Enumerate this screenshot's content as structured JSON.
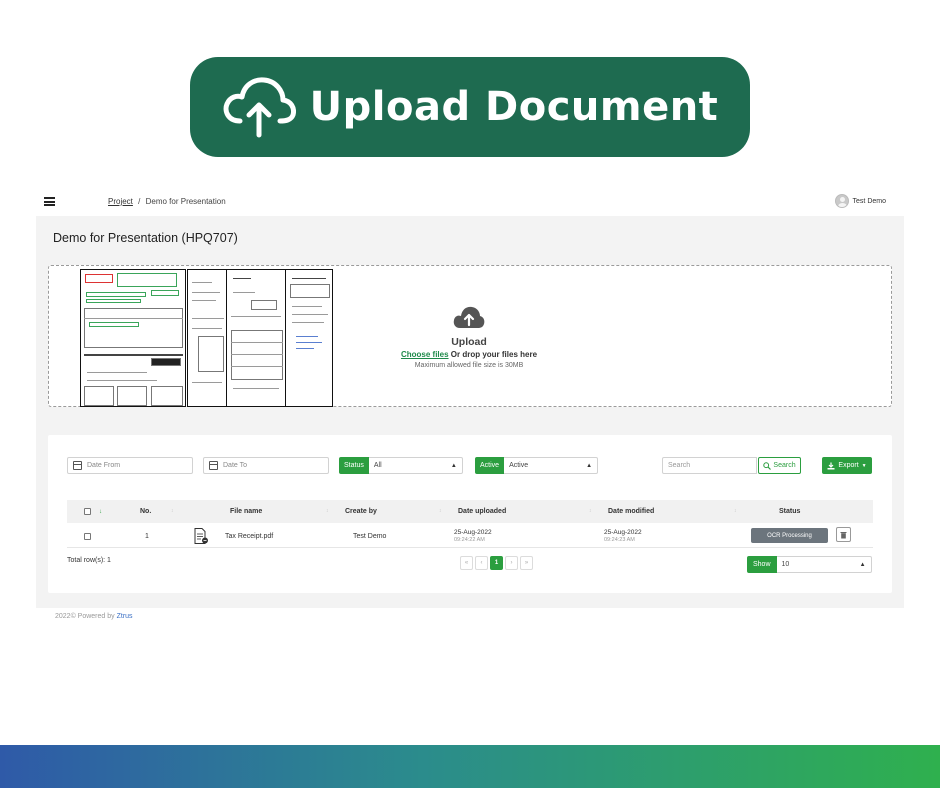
{
  "banner": {
    "title": "Upload Document",
    "icon": "cloud-upload-icon",
    "color": "#1e6b50"
  },
  "topbar": {
    "breadcrumb": {
      "parent": "Project",
      "separator": "/",
      "current": "Demo for Presentation"
    },
    "user_name": "Test Demo"
  },
  "page": {
    "title": "Demo for Presentation (HPQ707)"
  },
  "dropzone": {
    "heading": "Upload",
    "choose_label": "Choose files",
    "drop_label": " Or drop your files here",
    "limit": "Maximum allowed file size is 30MB"
  },
  "filters": {
    "date_from_placeholder": "Date From",
    "date_to_placeholder": "Date To",
    "status_label": "Status",
    "status_value": "All",
    "active_label": "Active",
    "active_value": "Active",
    "search_placeholder": "Search",
    "search_button": "Search",
    "export_button": "Export"
  },
  "table": {
    "columns": {
      "no": "No.",
      "file_name": "File name",
      "create_by": "Create by",
      "date_uploaded": "Date uploaded",
      "date_modified": "Date modified",
      "status": "Status"
    },
    "rows": [
      {
        "no": "1",
        "file_name": "Tax Receipt.pdf",
        "create_by": "Test Demo",
        "uploaded_date": "25-Aug-2022",
        "uploaded_time": "09:24:22 AM",
        "modified_date": "25-Aug-2022",
        "modified_time": "09:24:23 AM",
        "status": "OCR Processing"
      }
    ]
  },
  "pagination": {
    "total_text": "Total row(s): 1",
    "first": "«",
    "prev": "‹",
    "current": "1",
    "next": "›",
    "last": "»",
    "show_label": "Show",
    "show_value": "10"
  },
  "footer": {
    "prefix": "2022© Powered by ",
    "brand": "Ztrus"
  },
  "colors": {
    "accent": "#2b9e3f",
    "brand_dark": "#1e6b50",
    "badge_gray": "#6c757d",
    "gradient_start": "#2f5aa8",
    "gradient_end": "#2fb04e"
  }
}
